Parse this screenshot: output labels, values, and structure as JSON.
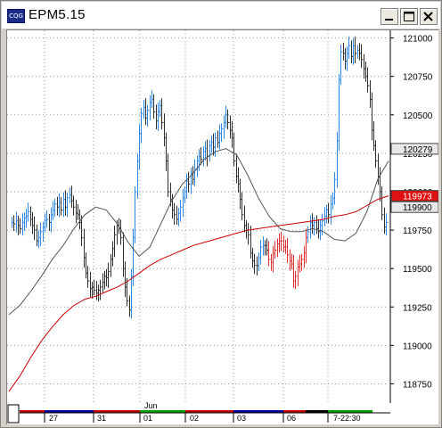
{
  "window": {
    "title": "EPM5.15",
    "app_icon_text": "CQG",
    "minimize_icon": "minimize-icon",
    "maximize_icon": "maximize-icon",
    "close_icon": "close-icon"
  },
  "colors": {
    "up": "#2e8ae6",
    "down": "#e03030",
    "neutral": "#303030",
    "ma_red": "#cc0000",
    "ma_gray": "#555555",
    "grid": "#999999"
  },
  "price_labels": {
    "last": "120279",
    "ma_red": "119973",
    "ma_gray": "119900"
  },
  "chart_data": {
    "type": "line",
    "title": "EPM5.15",
    "y_ticks": [
      "121000",
      "120750",
      "120500",
      "120250",
      "120000",
      "119750",
      "119500",
      "119250",
      "119000",
      "118750"
    ],
    "ylim": [
      118625,
      121050
    ],
    "x_month": "Jun",
    "x_ticks": [
      "27",
      "31",
      "01",
      "02",
      "03",
      "06",
      "7-22:30"
    ],
    "x_tick_bar_colors": [
      "#c00000",
      "#0000a0",
      "#c00000",
      "#00a000",
      "#c00000",
      "#0000a0",
      "#c00000",
      "#000000",
      "#00a000"
    ],
    "series": [
      {
        "name": "price",
        "values": [
          119800,
          119790,
          119810,
          119780,
          119760,
          119800,
          119830,
          119840,
          119870,
          119820,
          119780,
          119750,
          119680,
          119700,
          119740,
          119770,
          119810,
          119820,
          119800,
          119850,
          119880,
          119920,
          119900,
          119930,
          119880,
          119950,
          119900,
          119960,
          119980,
          119940,
          119900,
          119860,
          119850,
          119800,
          119700,
          119570,
          119470,
          119420,
          119370,
          119380,
          119360,
          119340,
          119360,
          119380,
          119410,
          119450,
          119440,
          119480,
          119560,
          119630,
          119720,
          119780,
          119760,
          119700,
          119500,
          119380,
          119290,
          119230,
          119450,
          119700,
          120000,
          120200,
          120380,
          120510,
          120550,
          120480,
          120530,
          120580,
          120600,
          120520,
          120460,
          120520,
          120560,
          120450,
          120350,
          120200,
          120000,
          119950,
          119880,
          119850,
          119820,
          119860,
          119900,
          119960,
          120000,
          120070,
          120050,
          120120,
          120080,
          120150,
          120200,
          120230,
          120210,
          120260,
          120280,
          120230,
          120300,
          120320,
          120290,
          120350,
          120320,
          120380,
          120410,
          120450,
          120500,
          120450,
          120400,
          120350,
          120200,
          120100,
          120050,
          119950,
          119850,
          119780,
          119750,
          119720,
          119600,
          119550,
          119520,
          119520,
          119570,
          119640,
          119650,
          119650,
          119620,
          119560,
          119540,
          119600,
          119620,
          119660,
          119680,
          119680,
          119640,
          119640,
          119590,
          119550,
          119530,
          119420,
          119450,
          119510,
          119530,
          119560,
          119600,
          119700,
          119740,
          119800,
          119780,
          119800,
          119760,
          119740,
          119780,
          119810,
          119840,
          119880,
          119850,
          119920,
          119960,
          120080,
          120330,
          120730,
          120910,
          120900,
          120850,
          120900,
          120950,
          120880,
          120950,
          120900,
          120920,
          120900,
          120860,
          120800,
          120750,
          120690,
          120600,
          120400,
          120300,
          120200,
          120100,
          120000,
          119850,
          119770,
          119800
        ]
      },
      {
        "name": "ma_red",
        "values": [
          118700,
          118800,
          118920,
          119030,
          119120,
          119200,
          119260,
          119300,
          119320,
          119350,
          119380,
          119420,
          119470,
          119520,
          119560,
          119590,
          119620,
          119650,
          119670,
          119690,
          119710,
          119730,
          119750,
          119760,
          119770,
          119780,
          119790,
          119800,
          119810,
          119820,
          119840,
          119850,
          119870,
          119910,
          119950,
          119973
        ]
      },
      {
        "name": "ma_gray",
        "values": [
          119200,
          119260,
          119350,
          119450,
          119560,
          119650,
          119760,
          119850,
          119900,
          119880,
          119790,
          119670,
          119580,
          119640,
          119790,
          119940,
          120050,
          120120,
          120210,
          120260,
          120280,
          120240,
          120110,
          119960,
          119840,
          119760,
          119740,
          119740,
          119760,
          119740,
          119690,
          119680,
          119730,
          119870,
          120080,
          120200
        ]
      }
    ]
  }
}
